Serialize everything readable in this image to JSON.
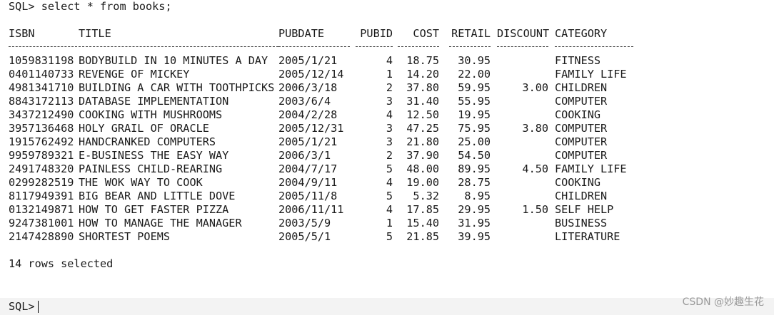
{
  "command_line": "SQL> select * from books;",
  "columns": {
    "isbn": "ISBN",
    "title": "TITLE",
    "pubdate": "PUBDATE",
    "pubid": "PUBID",
    "cost": "COST",
    "retail": "RETAIL",
    "discount": "DISCOUNT",
    "category": "CATEGORY"
  },
  "rows": [
    {
      "isbn": "1059831198",
      "title": "BODYBUILD IN 10 MINUTES A DAY",
      "pubdate": "2005/1/21",
      "pubid": "4",
      "cost": "18.75",
      "retail": "30.95",
      "discount": "",
      "category": "FITNESS"
    },
    {
      "isbn": "0401140733",
      "title": "REVENGE OF MICKEY",
      "pubdate": "2005/12/14",
      "pubid": "1",
      "cost": "14.20",
      "retail": "22.00",
      "discount": "",
      "category": "FAMILY LIFE"
    },
    {
      "isbn": "4981341710",
      "title": "BUILDING A CAR WITH TOOTHPICKS",
      "pubdate": "2006/3/18",
      "pubid": "2",
      "cost": "37.80",
      "retail": "59.95",
      "discount": "3.00",
      "category": "CHILDREN"
    },
    {
      "isbn": "8843172113",
      "title": "DATABASE IMPLEMENTATION",
      "pubdate": "2003/6/4",
      "pubid": "3",
      "cost": "31.40",
      "retail": "55.95",
      "discount": "",
      "category": "COMPUTER"
    },
    {
      "isbn": "3437212490",
      "title": "COOKING WITH MUSHROOMS",
      "pubdate": "2004/2/28",
      "pubid": "4",
      "cost": "12.50",
      "retail": "19.95",
      "discount": "",
      "category": "COOKING"
    },
    {
      "isbn": "3957136468",
      "title": "HOLY GRAIL OF ORACLE",
      "pubdate": "2005/12/31",
      "pubid": "3",
      "cost": "47.25",
      "retail": "75.95",
      "discount": "3.80",
      "category": "COMPUTER"
    },
    {
      "isbn": "1915762492",
      "title": "HANDCRANKED COMPUTERS",
      "pubdate": "2005/1/21",
      "pubid": "3",
      "cost": "21.80",
      "retail": "25.00",
      "discount": "",
      "category": "COMPUTER"
    },
    {
      "isbn": "9959789321",
      "title": "E-BUSINESS THE EASY WAY",
      "pubdate": "2006/3/1",
      "pubid": "2",
      "cost": "37.90",
      "retail": "54.50",
      "discount": "",
      "category": "COMPUTER"
    },
    {
      "isbn": "2491748320",
      "title": "PAINLESS CHILD-REARING",
      "pubdate": "2004/7/17",
      "pubid": "5",
      "cost": "48.00",
      "retail": "89.95",
      "discount": "4.50",
      "category": "FAMILY LIFE"
    },
    {
      "isbn": "0299282519",
      "title": "THE WOK WAY TO COOK",
      "pubdate": "2004/9/11",
      "pubid": "4",
      "cost": "19.00",
      "retail": "28.75",
      "discount": "",
      "category": "COOKING"
    },
    {
      "isbn": "8117949391",
      "title": "BIG BEAR AND LITTLE DOVE",
      "pubdate": "2005/11/8",
      "pubid": "5",
      "cost": "5.32",
      "retail": "8.95",
      "discount": "",
      "category": "CHILDREN"
    },
    {
      "isbn": "0132149871",
      "title": "HOW TO GET FASTER PIZZA",
      "pubdate": "2006/11/11",
      "pubid": "4",
      "cost": "17.85",
      "retail": "29.95",
      "discount": "1.50",
      "category": "SELF HELP"
    },
    {
      "isbn": "9247381001",
      "title": "HOW TO MANAGE THE MANAGER",
      "pubdate": "2003/5/9",
      "pubid": "1",
      "cost": "15.40",
      "retail": "31.95",
      "discount": "",
      "category": "BUSINESS"
    },
    {
      "isbn": "2147428890",
      "title": "SHORTEST POEMS",
      "pubdate": "2005/5/1",
      "pubid": "5",
      "cost": "21.85",
      "retail": "39.95",
      "discount": "",
      "category": "LITERATURE"
    }
  ],
  "rows_selected": "14 rows selected",
  "prompt": "SQL>",
  "watermark": "CSDN @妙趣生花"
}
